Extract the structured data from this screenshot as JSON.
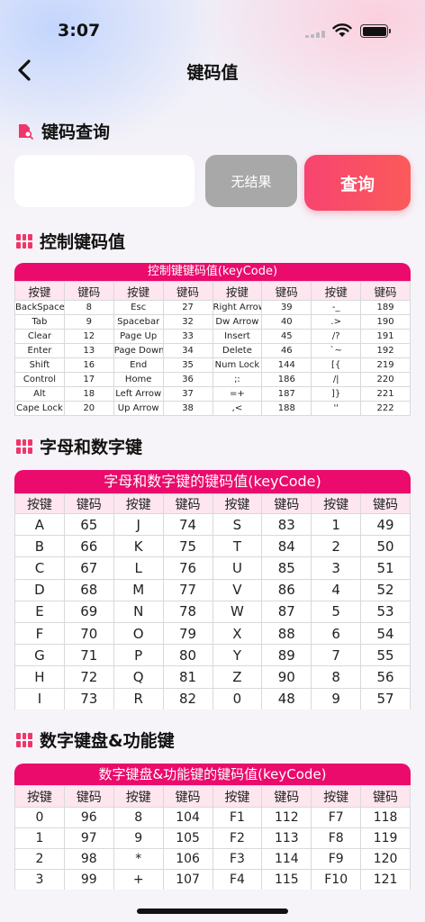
{
  "status_bar": {
    "time": "3:07"
  },
  "nav": {
    "title": "键码值"
  },
  "search_section": {
    "title": "键码查询",
    "input_value": "",
    "result_text": "无结果",
    "query_button": "查询"
  },
  "control_section": {
    "title": "控制键码值",
    "table_title": "控制键键码值(keyCode)",
    "headers": [
      "按键",
      "键码",
      "按键",
      "键码",
      "按键",
      "键码",
      "按键",
      "键码"
    ],
    "rows": [
      [
        "BackSpace",
        "8",
        "Esc",
        "27",
        "Right Arrow",
        "39",
        "-_",
        "189"
      ],
      [
        "Tab",
        "9",
        "Spacebar",
        "32",
        "Dw Arrow",
        "40",
        ".>",
        "190"
      ],
      [
        "Clear",
        "12",
        "Page Up",
        "33",
        "Insert",
        "45",
        "/?",
        "191"
      ],
      [
        "Enter",
        "13",
        "Page Down",
        "34",
        "Delete",
        "46",
        "`~",
        "192"
      ],
      [
        "Shift",
        "16",
        "End",
        "35",
        "Num Lock",
        "144",
        "[{",
        "219"
      ],
      [
        "Control",
        "17",
        "Home",
        "36",
        ";:",
        "186",
        "/|",
        "220"
      ],
      [
        "Alt",
        "18",
        "Left Arrow",
        "37",
        "=+",
        "187",
        "]}",
        "221"
      ],
      [
        "Cape Lock",
        "20",
        "Up Arrow",
        "38",
        ",<",
        "188",
        "''",
        "222"
      ]
    ]
  },
  "alnum_section": {
    "title": "字母和数字键",
    "table_title": "字母和数字键的键码值(keyCode)",
    "headers": [
      "按键",
      "键码",
      "按键",
      "键码",
      "按键",
      "键码",
      "按键",
      "键码"
    ],
    "rows": [
      [
        "A",
        "65",
        "J",
        "74",
        "S",
        "83",
        "1",
        "49"
      ],
      [
        "B",
        "66",
        "K",
        "75",
        "T",
        "84",
        "2",
        "50"
      ],
      [
        "C",
        "67",
        "L",
        "76",
        "U",
        "85",
        "3",
        "51"
      ],
      [
        "D",
        "68",
        "M",
        "77",
        "V",
        "86",
        "4",
        "52"
      ],
      [
        "E",
        "69",
        "N",
        "78",
        "W",
        "87",
        "5",
        "53"
      ],
      [
        "F",
        "70",
        "O",
        "79",
        "X",
        "88",
        "6",
        "54"
      ],
      [
        "G",
        "71",
        "P",
        "80",
        "Y",
        "89",
        "7",
        "55"
      ],
      [
        "H",
        "72",
        "Q",
        "81",
        "Z",
        "90",
        "8",
        "56"
      ],
      [
        "I",
        "73",
        "R",
        "82",
        "0",
        "48",
        "9",
        "57"
      ]
    ]
  },
  "numpad_section": {
    "title": "数字键盘&功能键",
    "table_title": "数字键盘&功能键的键码值(keyCode)",
    "headers": [
      "按键",
      "键码",
      "按键",
      "键码",
      "按键",
      "键码",
      "按键",
      "键码"
    ],
    "rows": [
      [
        "0",
        "96",
        "8",
        "104",
        "F1",
        "112",
        "F7",
        "118"
      ],
      [
        "1",
        "97",
        "9",
        "105",
        "F2",
        "113",
        "F8",
        "119"
      ],
      [
        "2",
        "98",
        "*",
        "106",
        "F3",
        "114",
        "F9",
        "120"
      ],
      [
        "3",
        "99",
        "+",
        "107",
        "F4",
        "115",
        "F10",
        "121"
      ]
    ]
  },
  "icons": {
    "back": "chevron-left-icon",
    "search_section": "document-search-icon",
    "table_sections": "grid-icon"
  },
  "colors": {
    "accent": "#ea0b6c",
    "query_button": "#f74470",
    "result_box": "#a8a8a8",
    "header_cell": "#fde6ef"
  }
}
